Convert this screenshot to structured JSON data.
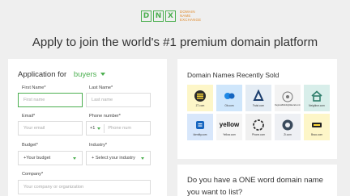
{
  "brand": {
    "letters": [
      "D",
      "N",
      "X"
    ],
    "tagline": [
      "DOMAIN",
      "NAME",
      "EXCHANGE"
    ],
    "accent": "#4caf50",
    "tag_color": "#e08a2b"
  },
  "headline": "Apply to join the world's #1 premium domain platform",
  "application": {
    "title": "Application for",
    "role": "buyers",
    "fields": {
      "first_name": {
        "label": "First Name*",
        "placeholder": "First name"
      },
      "last_name": {
        "label": "Last Name*",
        "placeholder": "Last name"
      },
      "email": {
        "label": "Email*",
        "placeholder": "Your email"
      },
      "phone": {
        "label": "Phone number*",
        "country_code": "+1",
        "placeholder": "Phone num"
      },
      "budget": {
        "label": "Budget*",
        "value": "+Your budget"
      },
      "industry": {
        "label": "Industry*",
        "value": "+ Select your industry"
      },
      "company": {
        "label": "Company*",
        "placeholder": "Your company or organization"
      }
    }
  },
  "sold": {
    "title": "Domain Names Recently Sold",
    "items": [
      {
        "name": "Z7.com",
        "bg": "#fdf6c8",
        "icon": "z7-logo-icon"
      },
      {
        "name": "Ob.com",
        "bg": "#cfe6fb",
        "icon": "ob-logo-icon"
      },
      {
        "name": "Twist.com",
        "bg": "#e4ecf4",
        "icon": "twist-logo-icon"
      },
      {
        "name": "RegionalBuildingMaterials.com",
        "bg": "#f3f3f3",
        "icon": "regional-logo-icon"
      },
      {
        "name": "Neighbor.com",
        "bg": "#d8eeea",
        "icon": "neighbor-house-icon"
      },
      {
        "name": "Identity.com",
        "bg": "#d8e7fb",
        "icon": "identity-logo-icon"
      },
      {
        "name": "Yellow.com",
        "bg": "#f5f5f5",
        "icon": "yellow-wordmark-icon",
        "word": "yellow"
      },
      {
        "name": "Phone.com",
        "bg": "#f0f0f0",
        "icon": "phone-logo-icon"
      },
      {
        "name": "Zi.com",
        "bg": "#eef0f4",
        "icon": "zi-logo-icon"
      },
      {
        "name": "Bsco.com",
        "bg": "#fdf6c8",
        "icon": "bsco-logo-icon"
      }
    ]
  },
  "question": "Do you have a ONE word domain name you want to list?"
}
